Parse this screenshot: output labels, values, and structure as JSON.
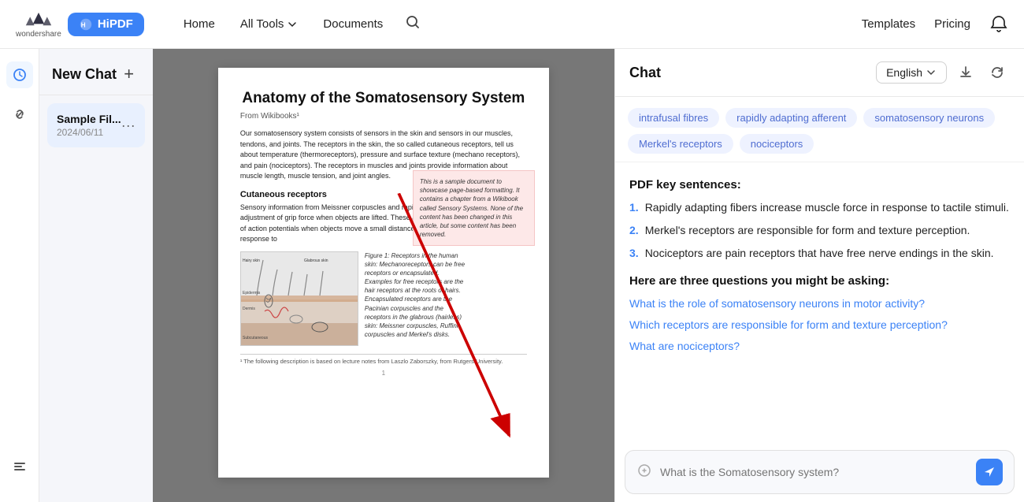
{
  "topnav": {
    "brand_name": "wondershare",
    "hipdf_label": "HiPDF",
    "links": [
      {
        "label": "Home",
        "id": "home"
      },
      {
        "label": "All Tools",
        "id": "all-tools",
        "has_dropdown": true
      },
      {
        "label": "Documents",
        "id": "documents"
      }
    ],
    "right_links": [
      {
        "label": "Templates",
        "id": "templates"
      },
      {
        "label": "Pricing",
        "id": "pricing"
      }
    ]
  },
  "sidebar": {
    "new_chat_label": "New Chat",
    "chat_list": [
      {
        "name": "Sample Fil...",
        "date": "2024/06/11",
        "id": "chat1"
      }
    ]
  },
  "chat_panel": {
    "title": "Chat",
    "language": "English",
    "tags": [
      "intrafusal fibres",
      "rapidly adapting afferent",
      "somatosensory neurons",
      "Merkel's receptors",
      "nociceptors"
    ],
    "key_sentences_title": "PDF key sentences:",
    "key_sentences": [
      {
        "num": "1.",
        "text": "Rapidly adapting fibers increase muscle force in response to tactile stimuli."
      },
      {
        "num": "2.",
        "text": "Merkel's receptors are responsible for form and texture perception."
      },
      {
        "num": "3.",
        "text": "Nociceptors are pain receptors that have free nerve endings in the skin."
      }
    ],
    "questions_title": "Here are three questions you might be asking:",
    "questions": [
      "What is the role of somatosensory neurons in motor activity?",
      "Which receptors are responsible for form and texture perception?",
      "What are nociceptors?"
    ],
    "input_placeholder": "What is the Somatosensory system?"
  },
  "pdf": {
    "title": "Anatomy of the Somatosensory System",
    "subtitle": "From Wikibooks¹",
    "callout": "This is a sample document to showcase page-based formatting. It contains a chapter from a Wikibook called Sensory Systems. None of the content has been changed in this article, but some content has been removed.",
    "body1": "Our somatosensory system consists of sensors in the skin and sensors in our muscles, tendons, and joints. The receptors in the skin, the so called cutaneous receptors, tell us about temperature (thermoreceptors), pressure and surface texture (mechano receptors), and pain (nociceptors). The receptors in muscles and joints provide information about muscle length, muscle tension, and joint angles.",
    "section1": "Cutaneous receptors",
    "body2": "Sensory information from Meissner corpuscles and rapidly adapting afferents leads to adjustment of grip force when objects are lifted. These afferents respond with a brief burst of action potentials when objects move a small distance along the early stages of lifting. In response to",
    "figure_caption": "Figure 1: Receptors in the human skin: Mechanoreceptors can be free receptors or encapsulated. Examples for free receptors are the hair receptors at the roots of hairs. Encapsulated receptors are the Pacinian corpuscles and the receptors in the glabrous (hairless) skin: Meissner corpuscles, Ruffini corpuscles and Merkel's disks.",
    "footnote": "¹ The following description is based on lecture notes from Laszlo Zaborszky, from Rutgers University.",
    "page_num": "1"
  }
}
